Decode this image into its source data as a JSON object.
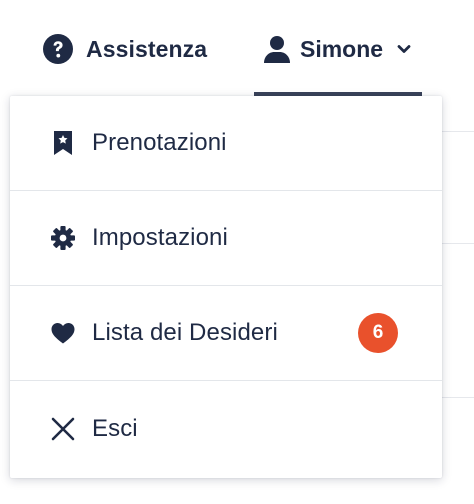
{
  "header": {
    "help_label": "Assistenza",
    "user_name": "Simone",
    "icons": {
      "help": "question-circle-icon",
      "user": "user-icon",
      "chevron": "chevron-down-icon"
    }
  },
  "menu": {
    "items": [
      {
        "label": "Prenotazioni",
        "icon": "bookmark-icon"
      },
      {
        "label": "Impostazioni",
        "icon": "gear-icon"
      },
      {
        "label": "Lista dei Desideri",
        "icon": "heart-icon",
        "badge": "6"
      },
      {
        "label": "Esci",
        "icon": "close-icon"
      }
    ]
  },
  "colors": {
    "text": "#1f2a44",
    "badge": "#e9512c",
    "underline": "#3a4359",
    "divider": "#e3e6ea"
  }
}
